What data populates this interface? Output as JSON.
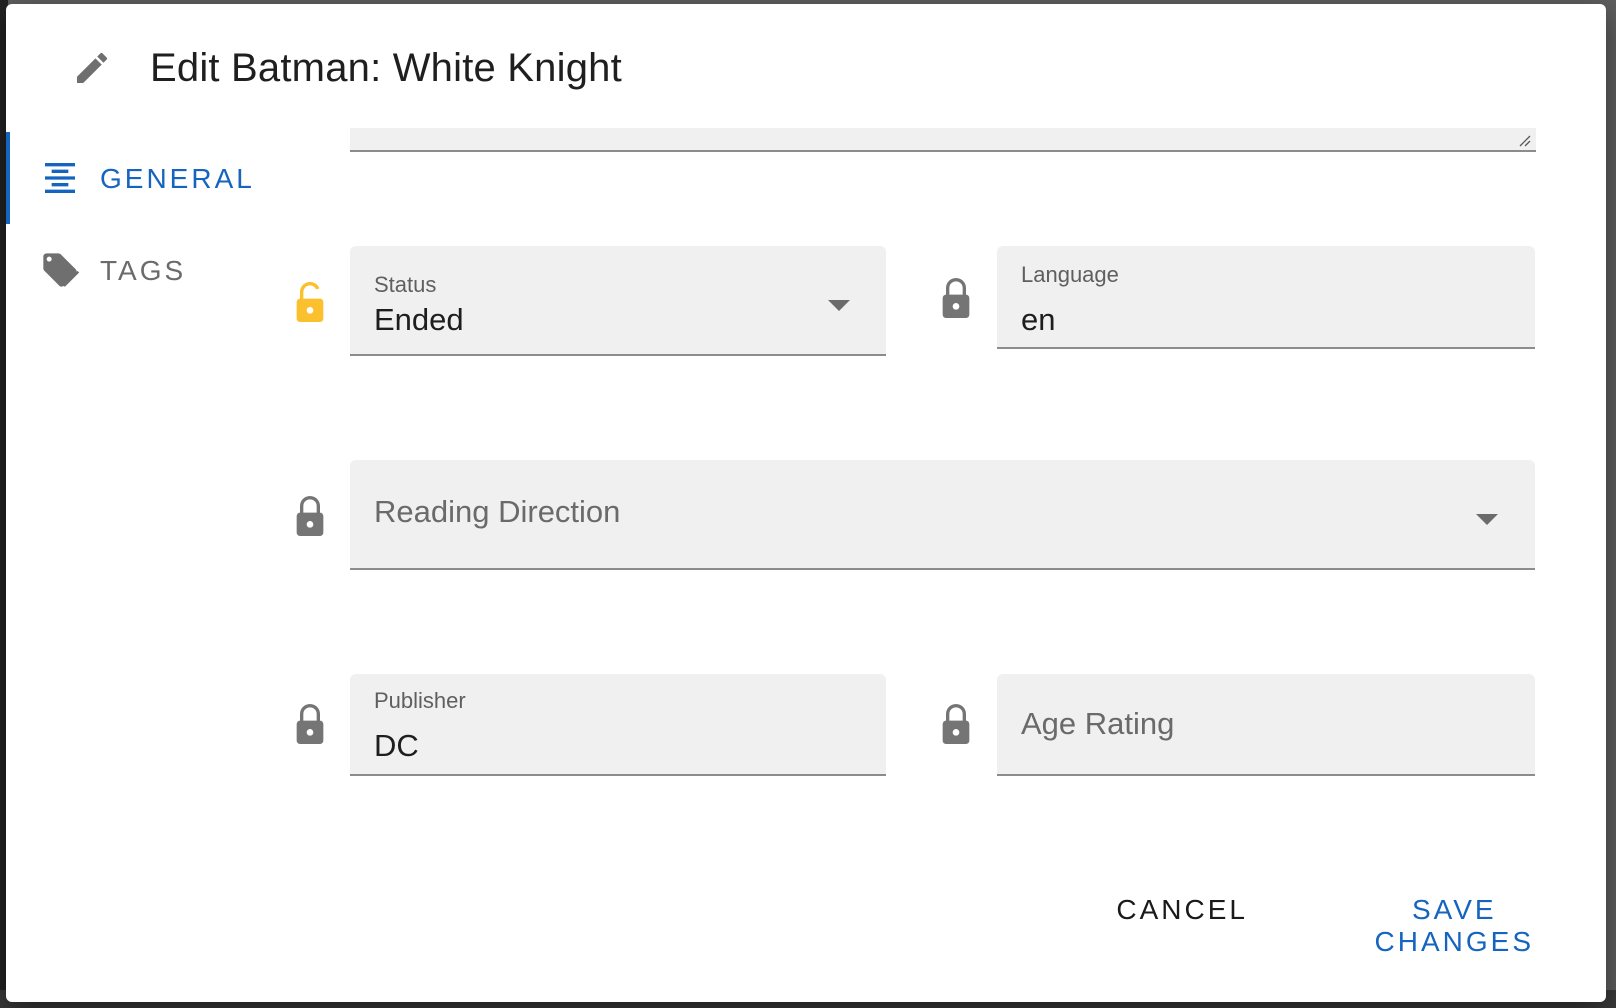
{
  "dialog": {
    "title": "Edit Batman: White Knight",
    "icon": "pencil-icon"
  },
  "tabs": [
    {
      "label": "GENERAL",
      "icon": "format-align-center-icon",
      "active": true
    },
    {
      "label": "TAGS",
      "icon": "tags-icon",
      "active": false
    }
  ],
  "fields": {
    "status": {
      "label": "Status",
      "value": "Ended",
      "locked": true,
      "lock_color": "#fbc02d"
    },
    "language": {
      "label": "Language",
      "value": "en",
      "locked": false
    },
    "reading_direction": {
      "placeholder": "Reading Direction",
      "locked": false
    },
    "publisher": {
      "label": "Publisher",
      "value": "DC",
      "locked": false
    },
    "age_rating": {
      "placeholder": "Age Rating",
      "locked": false
    }
  },
  "actions": {
    "cancel_label": "CANCEL",
    "save_label": "SAVE CHANGES"
  },
  "colors": {
    "accent": "#1565c0",
    "lock_active": "#fbc02d",
    "lock_inactive": "#757575"
  }
}
